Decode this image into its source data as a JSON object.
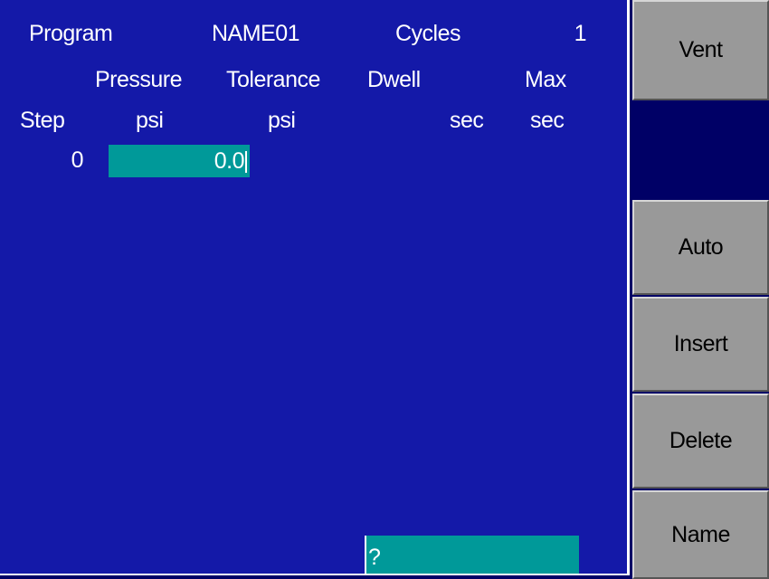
{
  "header": {
    "program_label": "Program",
    "program_name": "NAME01",
    "cycles_label": "Cycles",
    "cycles_value": "1"
  },
  "columns": {
    "pressure_label": "Pressure",
    "pressure_unit": "psi",
    "tolerance_label": "Tolerance",
    "tolerance_unit": "psi",
    "dwell_label": "Dwell",
    "dwell_unit": "sec",
    "max_label": "Max",
    "max_unit": "sec",
    "step_label": "Step"
  },
  "rows": [
    {
      "step": "0",
      "pressure": "0.0"
    }
  ],
  "prompt": {
    "value": "?"
  },
  "softkeys": {
    "vent": "Vent",
    "auto": "Auto",
    "insert": "Insert",
    "delete": "Delete",
    "name": "Name"
  },
  "colors": {
    "panel_bg": "#1419a8",
    "field_bg": "#009999",
    "softkey_bg": "#999999",
    "screen_bg": "#000066"
  }
}
